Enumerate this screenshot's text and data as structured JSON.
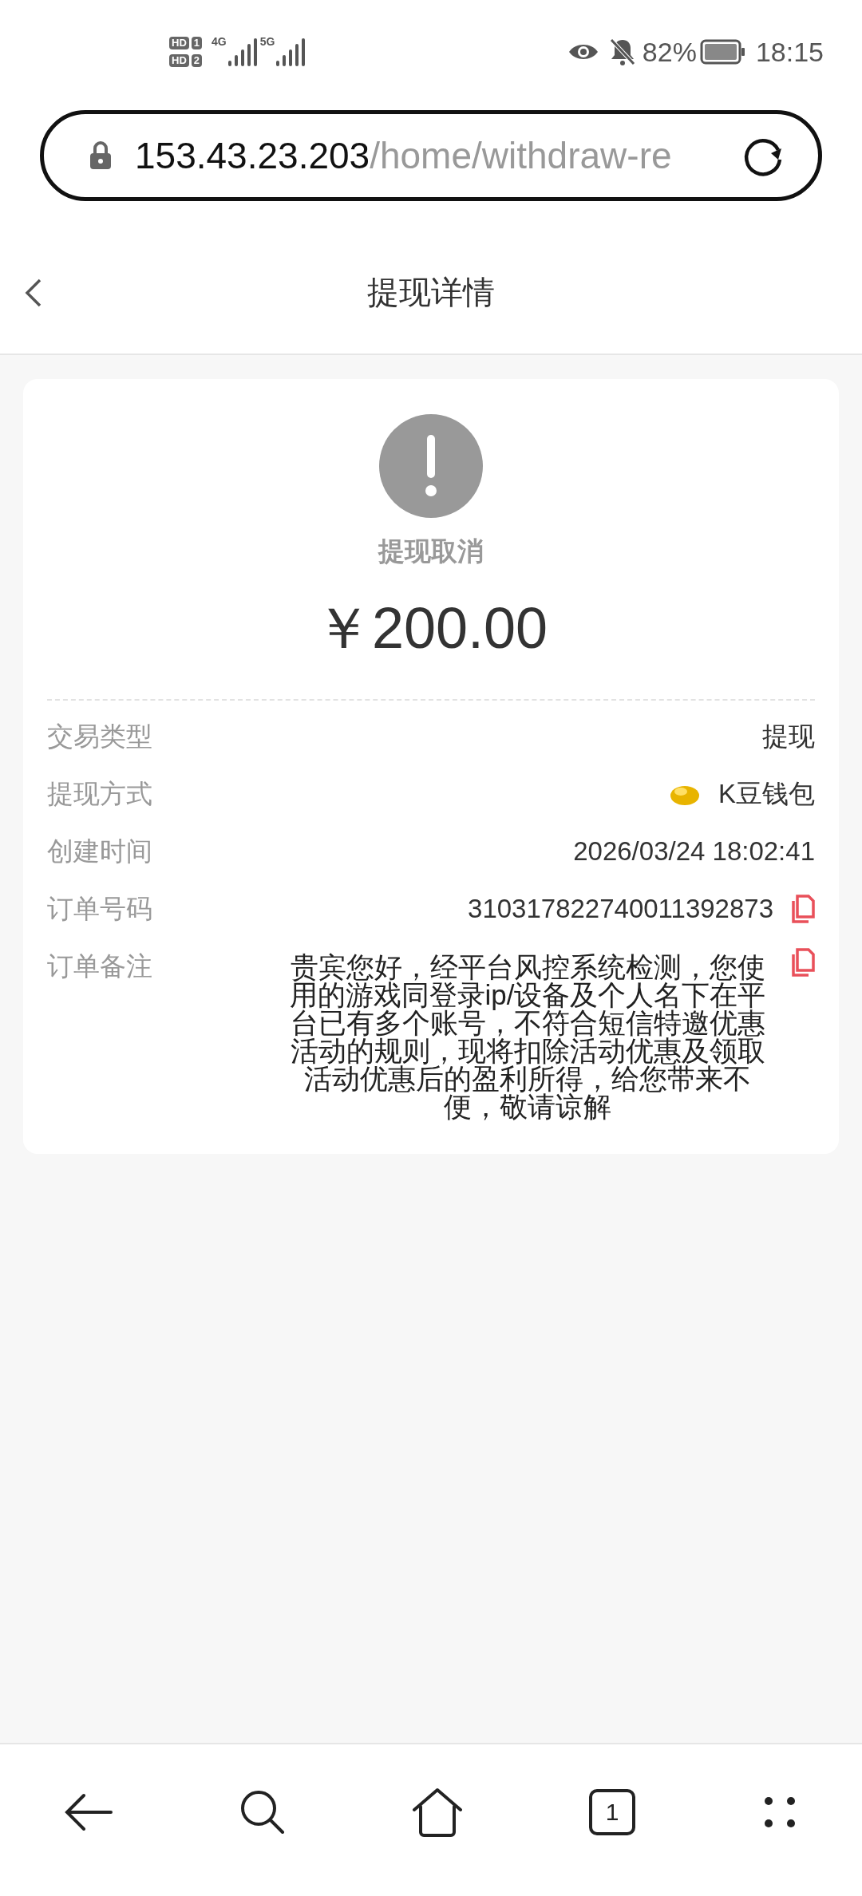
{
  "status_bar": {
    "sims": [
      {
        "badge": "HD",
        "slot": "1"
      },
      {
        "badge": "HD",
        "slot": "2"
      }
    ],
    "networks": [
      "4G",
      "5G"
    ],
    "battery": "82%",
    "time": "18:15"
  },
  "address_bar": {
    "host": "153.43.23.203",
    "path": "/home/withdraw-re"
  },
  "header": {
    "title": "提现详情"
  },
  "detail": {
    "status": "提现取消",
    "amount": "￥200.00",
    "rows": [
      {
        "kind": "text",
        "label": "交易类型",
        "value": "提现"
      },
      {
        "kind": "wallet",
        "label": "提现方式",
        "value": "K豆钱包"
      },
      {
        "kind": "text",
        "label": "创建时间",
        "value": "2026/03/24 18:02:41"
      },
      {
        "kind": "copy",
        "label": "订单号码",
        "value": "310317822740011392873"
      },
      {
        "kind": "note",
        "label": "订单备注",
        "value": "贵宾您好，经平台风控系统检测，您使用的游戏同登录ip/设备及个人名下在平台已有多个账号，不符合短信特邀优惠活动的规则，现将扣除活动优惠及领取活动优惠后的盈利所得，给您带来不便，敬请谅解"
      }
    ]
  },
  "bottom_nav": {
    "tab_count": "1"
  }
}
